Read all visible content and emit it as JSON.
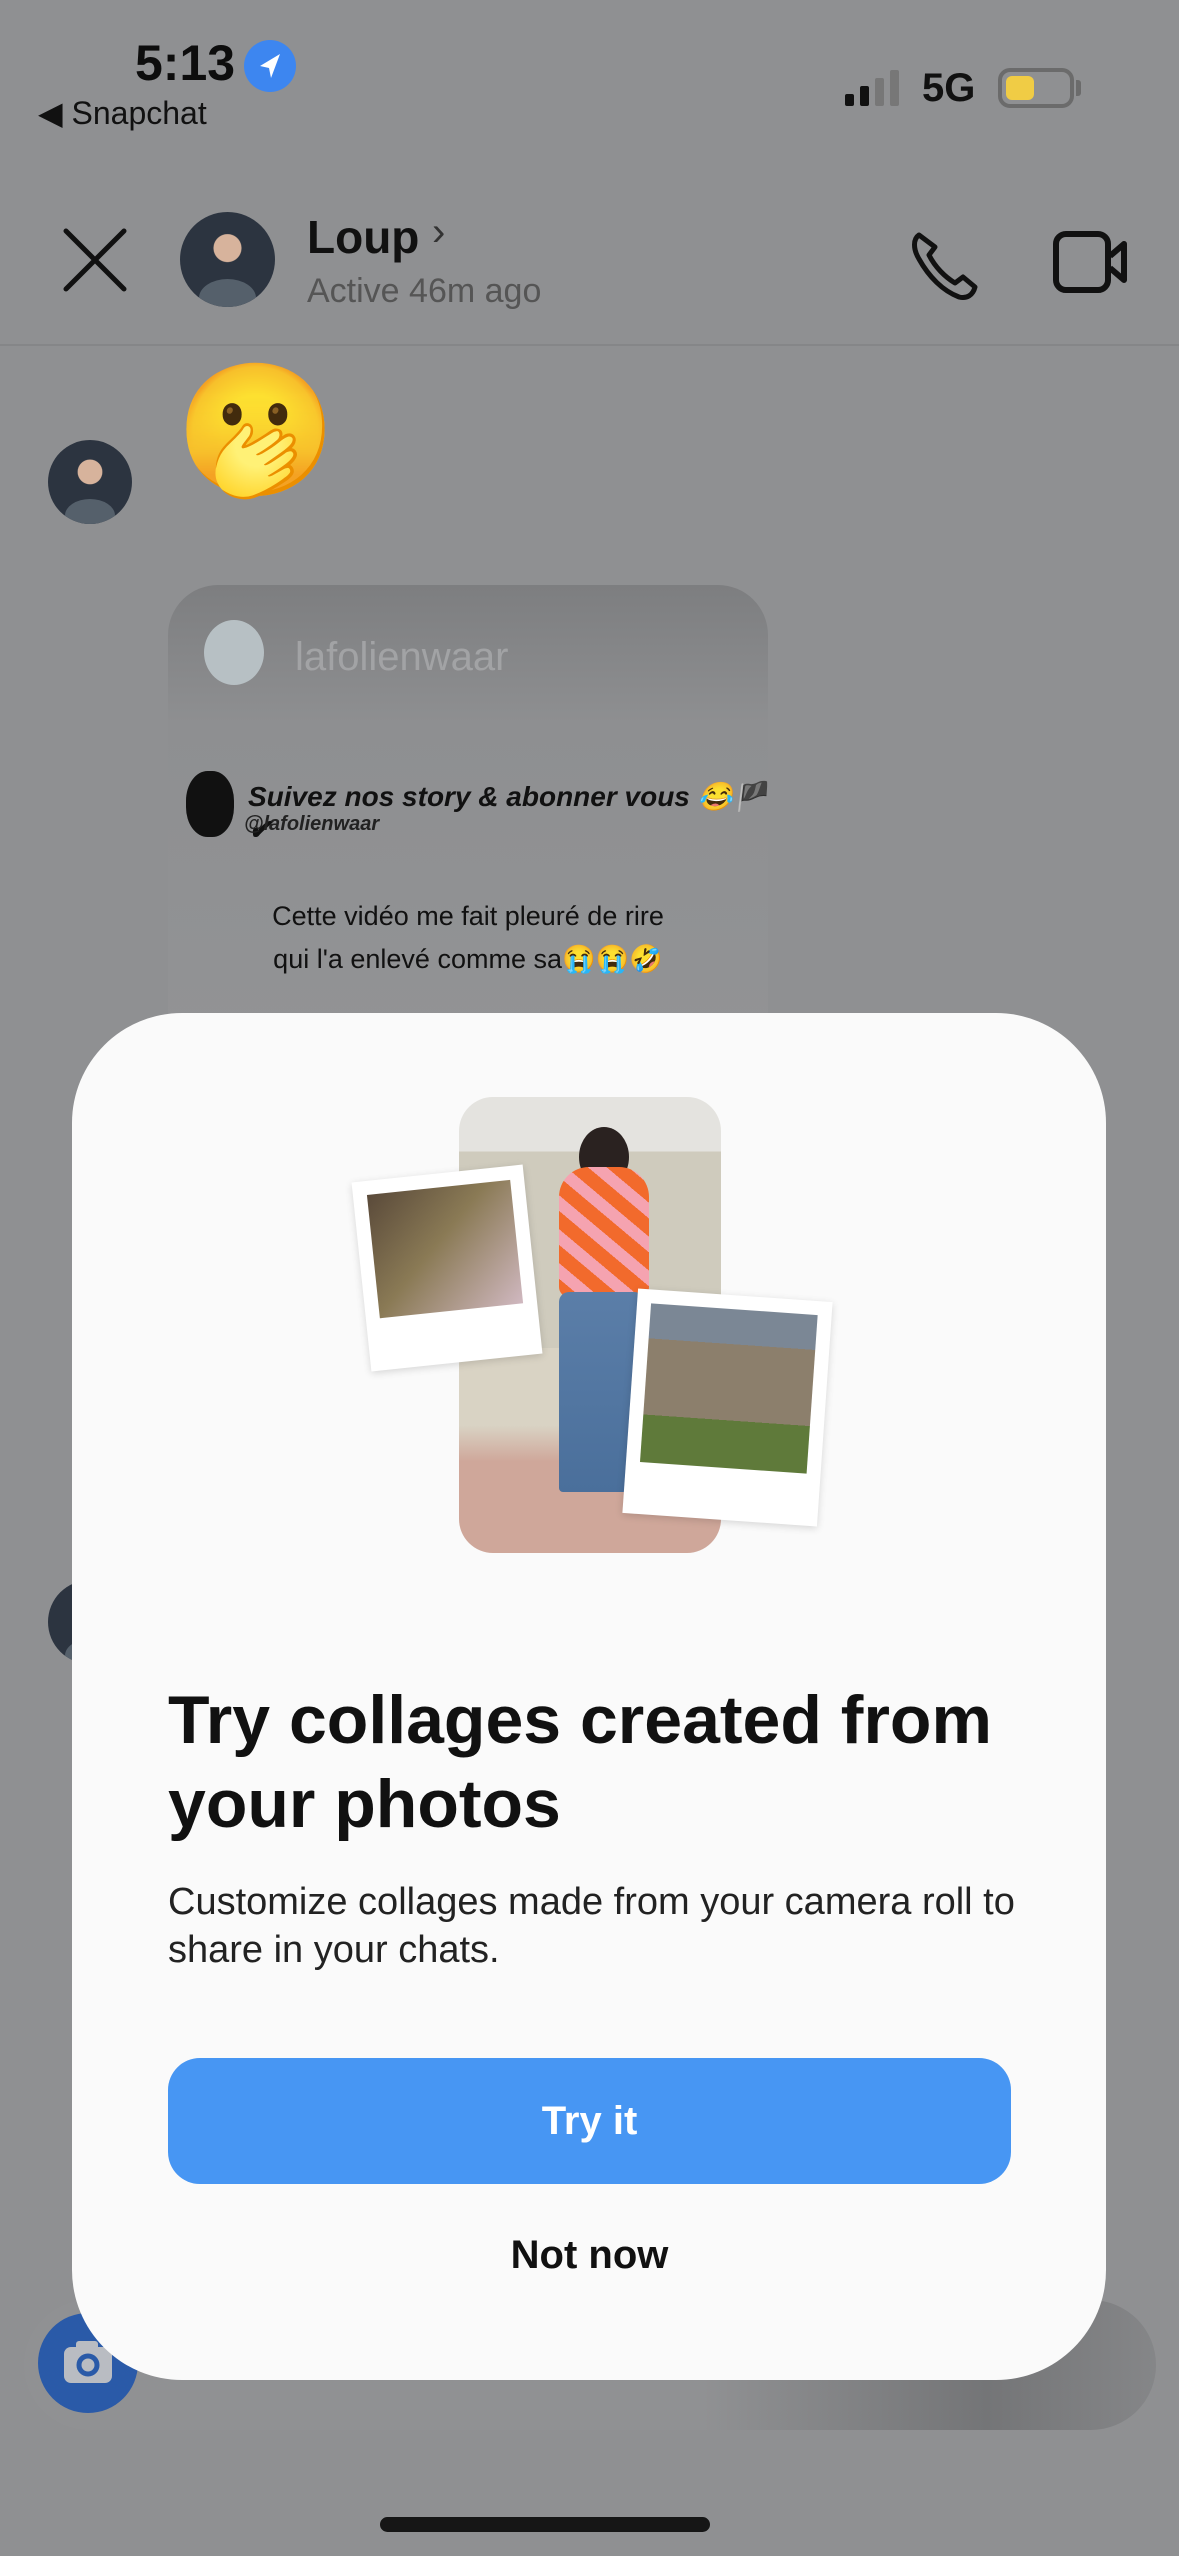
{
  "status_bar": {
    "time": "5:13",
    "back_app": "Snapchat",
    "network": "5G",
    "location_icon": "location-arrow-icon",
    "battery_color": "#f0cc45"
  },
  "header": {
    "name": "Loup",
    "status": "Active 46m ago",
    "close_icon": "close-icon",
    "call_icon": "phone-icon",
    "video_icon": "video-icon"
  },
  "chat": {
    "emoji": "🫢",
    "story": {
      "username": "lafolienwaar",
      "overlay_title": "Suivez nos story & abonner vous 😂🏴 ✔",
      "overlay_handle": "@lafolienwaar",
      "caption_line1": "Cette vidéo me fait pleuré de rire",
      "caption_line2": "qui l'a enlevé comme sa😭😭🤣"
    }
  },
  "modal": {
    "title": "Try collages created from your photos",
    "subtitle": "Customize collages made from your camera roll to share in your chats.",
    "primary_button": "Try it",
    "secondary_button": "Not now",
    "accent_color": "#4796f3"
  },
  "composer": {
    "camera_icon": "camera-icon",
    "camera_color": "#2a5aa8"
  }
}
